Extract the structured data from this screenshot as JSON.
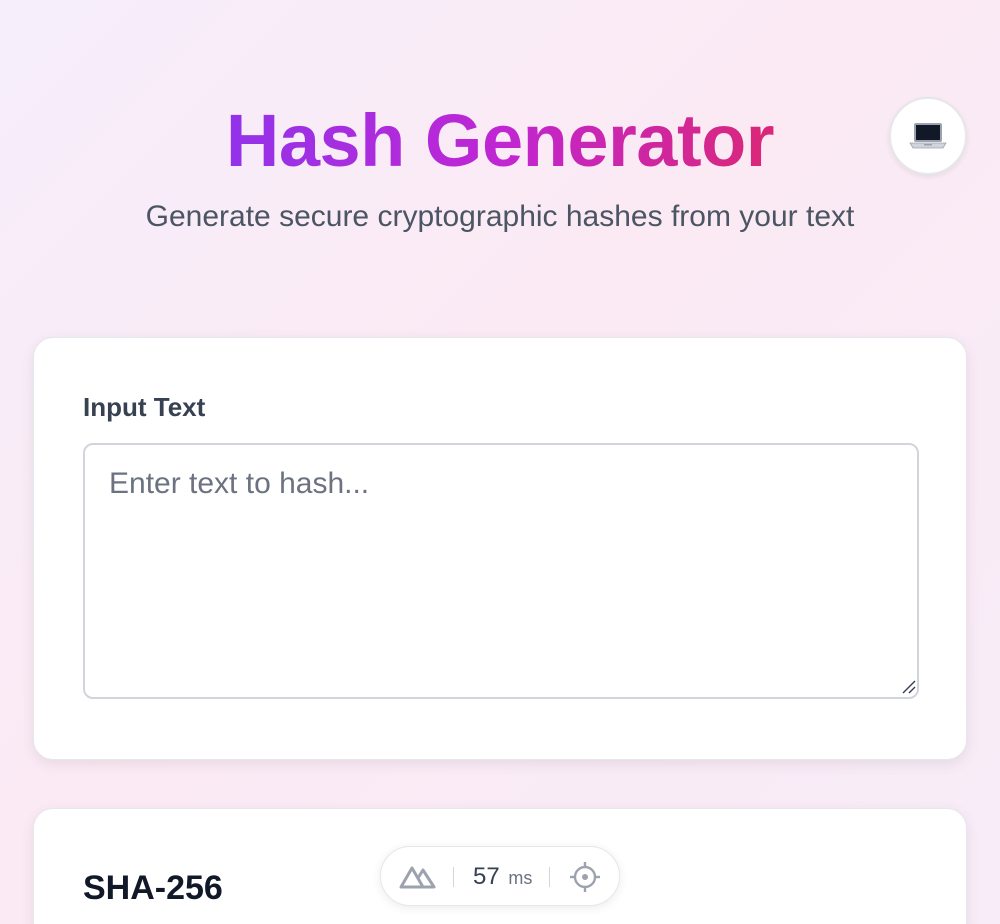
{
  "header": {
    "title": "Hash Generator",
    "subtitle": "Generate secure cryptographic hashes from your text",
    "mode_icon": "laptop-icon"
  },
  "input_card": {
    "label": "Input Text",
    "value": "",
    "placeholder": "Enter text to hash..."
  },
  "hash_card": {
    "title": "SHA-256"
  },
  "perf_badge": {
    "logo_icon": "nuxt-logo-icon",
    "time_value": "57",
    "time_unit": "ms",
    "inspect_icon": "crosshair-icon"
  },
  "colors": {
    "gradient_start": "#9333ea",
    "gradient_mid": "#c026d3",
    "gradient_end": "#db2777"
  }
}
